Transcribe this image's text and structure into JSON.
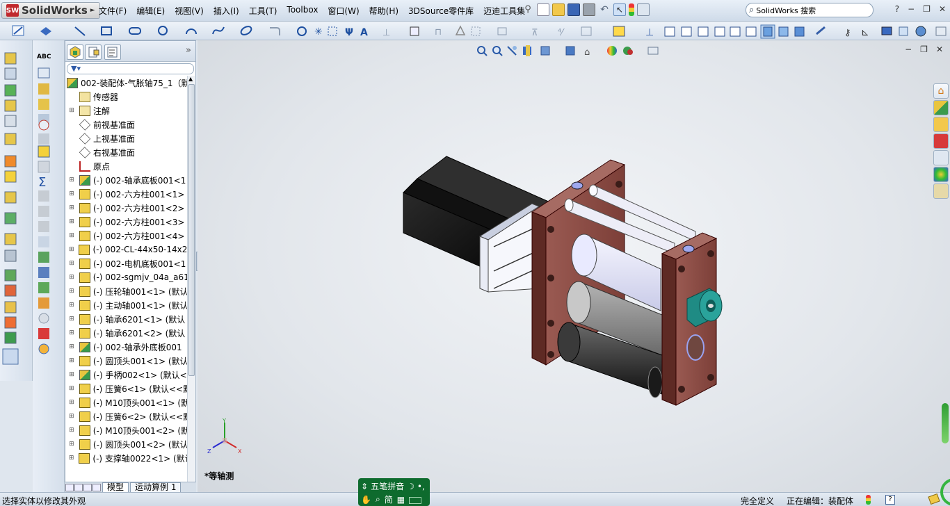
{
  "app": {
    "name": "SolidWorks",
    "logo_badge": "SW"
  },
  "menu": [
    "文件(F)",
    "编辑(E)",
    "视图(V)",
    "插入(I)",
    "工具(T)",
    "Toolbox",
    "窗口(W)",
    "帮助(H)",
    "3DSource零件库",
    "迈迪工具集"
  ],
  "search": {
    "placeholder": "SolidWorks 搜索"
  },
  "window_controls": {
    "help": "?",
    "minimize": "−",
    "restore": "❐",
    "close": "✕"
  },
  "tree": {
    "tabs": [
      "feature-manager",
      "property-manager",
      "configuration-manager"
    ],
    "root": "002-装配体-气胀轴75_1（默",
    "items": [
      {
        "label": "传感器",
        "icon": "sensor",
        "expand": ""
      },
      {
        "label": "注解",
        "icon": "annotation",
        "expand": "+"
      },
      {
        "label": "前视基准面",
        "icon": "plane",
        "expand": ""
      },
      {
        "label": "上视基准面",
        "icon": "plane",
        "expand": ""
      },
      {
        "label": "右视基准面",
        "icon": "plane",
        "expand": ""
      },
      {
        "label": "原点",
        "icon": "origin",
        "expand": ""
      },
      {
        "label": "(-) 002-轴承底板001<1",
        "icon": "subassembly",
        "expand": "+"
      },
      {
        "label": "(-) 002-六方柱001<1>",
        "icon": "part",
        "expand": "+"
      },
      {
        "label": "(-) 002-六方柱001<2>",
        "icon": "part",
        "expand": "+"
      },
      {
        "label": "(-) 002-六方柱001<3>",
        "icon": "part",
        "expand": "+"
      },
      {
        "label": "(-) 002-六方柱001<4>",
        "icon": "part",
        "expand": "+"
      },
      {
        "label": "(-) 002-CL-44x50-14x20",
        "icon": "part",
        "expand": "+"
      },
      {
        "label": "(-) 002-电机底板001<1",
        "icon": "part",
        "expand": "+"
      },
      {
        "label": "(-) 002-sgmjv_04a_a61",
        "icon": "part",
        "expand": "+"
      },
      {
        "label": "(-) 压轮轴001<1> (默认",
        "icon": "part",
        "expand": "+"
      },
      {
        "label": "(-) 主动轴001<1> (默认",
        "icon": "part",
        "expand": "+"
      },
      {
        "label": "(-) 轴承6201<1> (默认",
        "icon": "part",
        "expand": "+"
      },
      {
        "label": "(-) 轴承6201<2> (默认",
        "icon": "part",
        "expand": "+"
      },
      {
        "label": "(-) 002-轴承外底板001",
        "icon": "subassembly",
        "expand": "+"
      },
      {
        "label": "(-) 圆顶头001<1> (默认",
        "icon": "part",
        "expand": "+"
      },
      {
        "label": "(-) 手柄002<1> (默认<",
        "icon": "subassembly",
        "expand": "+"
      },
      {
        "label": "(-) 压簧6<1> (默认<<默",
        "icon": "part",
        "expand": "+"
      },
      {
        "label": "(-) M10顶头001<1> (默",
        "icon": "part",
        "expand": "+"
      },
      {
        "label": "(-) 压簧6<2> (默认<<默",
        "icon": "part",
        "expand": "+"
      },
      {
        "label": "(-) M10顶头001<2> (默",
        "icon": "part",
        "expand": "+"
      },
      {
        "label": "(-) 圆顶头001<2> (默认",
        "icon": "part",
        "expand": "+"
      },
      {
        "label": "(-) 支撑轴0022<1> (默认",
        "icon": "part",
        "expand": "+"
      }
    ]
  },
  "bottom_tabs": [
    "模型",
    "运动算例 1"
  ],
  "viewport": {
    "view_name": "*等轴测",
    "triad": {
      "x": "X",
      "y": "Y",
      "z": "Z"
    }
  },
  "status": {
    "left": "选择实体以修改其外观",
    "constraint": "完全定义",
    "editing": "正在编辑：装配体",
    "help": "?"
  },
  "ime": {
    "name": "五笔拼音",
    "mode": "简"
  }
}
